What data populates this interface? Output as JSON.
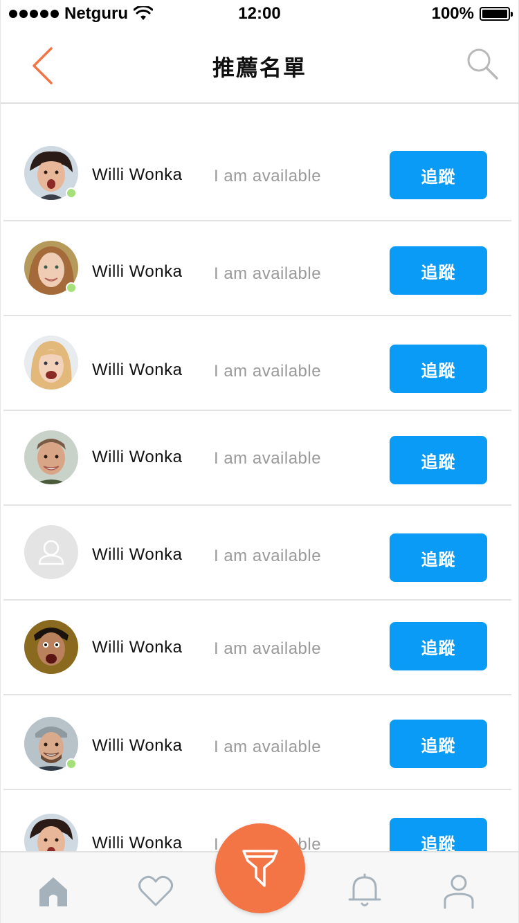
{
  "status_bar": {
    "carrier": "Netguru",
    "time": "12:00",
    "battery": "100%"
  },
  "nav": {
    "title": "推薦名單",
    "back_icon": "chevron-left-icon",
    "search_icon": "search-icon"
  },
  "colors": {
    "accent": "#f37445",
    "follow_button": "#0a9bf7",
    "online": "#a6e07b",
    "status_text": "#9a9a9a"
  },
  "users": [
    {
      "name": "Willi Wonka",
      "status": "I am available",
      "action": "追蹤",
      "online": true
    },
    {
      "name": "Willi Wonka",
      "status": "I am available",
      "action": "追蹤",
      "online": true
    },
    {
      "name": "Willi Wonka",
      "status": "I am available",
      "action": "追蹤",
      "online": false
    },
    {
      "name": "Willi Wonka",
      "status": "I am available",
      "action": "追蹤",
      "online": false
    },
    {
      "name": "Willi Wonka",
      "status": "I am available",
      "action": "追蹤",
      "online": false
    },
    {
      "name": "Willi Wonka",
      "status": "I am available",
      "action": "追蹤",
      "online": false
    },
    {
      "name": "Willi Wonka",
      "status": "I am available",
      "action": "追蹤",
      "online": true
    },
    {
      "name": "Willi Wonka",
      "status": "I am available",
      "action": "追蹤",
      "online": false
    }
  ],
  "tab_bar": {
    "tabs": [
      "home-icon",
      "heart-icon",
      "bell-icon",
      "profile-icon"
    ],
    "fab_icon": "filter-icon"
  }
}
